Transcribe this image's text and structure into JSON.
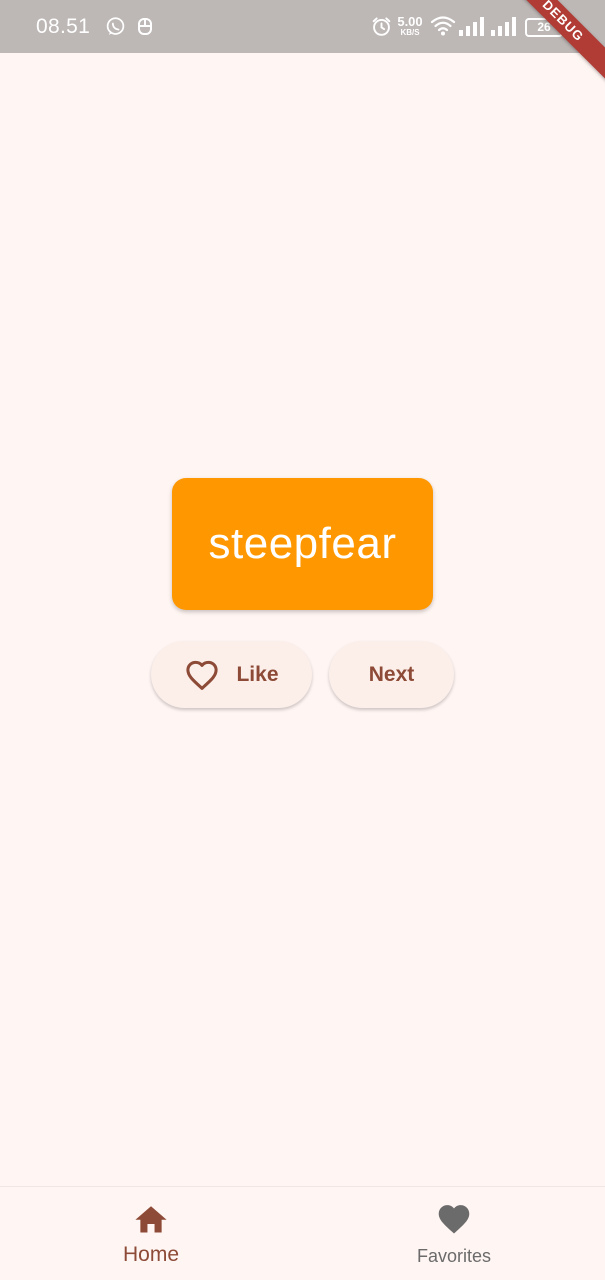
{
  "status_bar": {
    "time": "08.51",
    "speed_value": "5.00",
    "speed_unit": "KB/S",
    "battery": "26",
    "icons": [
      "whatsapp-icon",
      "usb-debug-icon",
      "alarm-icon",
      "wifi-icon",
      "signal-icon",
      "signal-icon"
    ]
  },
  "debug_banner": "DEBUG",
  "word_card": {
    "word": "steepfear",
    "color": "#ff9800"
  },
  "actions": {
    "like_label": "Like",
    "like_icon": "heart-outline-icon",
    "next_label": "Next"
  },
  "bottom_nav": {
    "items": [
      {
        "label": "Home",
        "icon": "home-icon",
        "selected": true
      },
      {
        "label": "Favorites",
        "icon": "heart-filled-icon",
        "selected": false
      }
    ]
  },
  "colors": {
    "background": "#fff5f3",
    "accent": "#8d4a36",
    "card": "#ff9800",
    "status_bar": "#bdb7b5",
    "inactive": "#6b6b6b"
  }
}
